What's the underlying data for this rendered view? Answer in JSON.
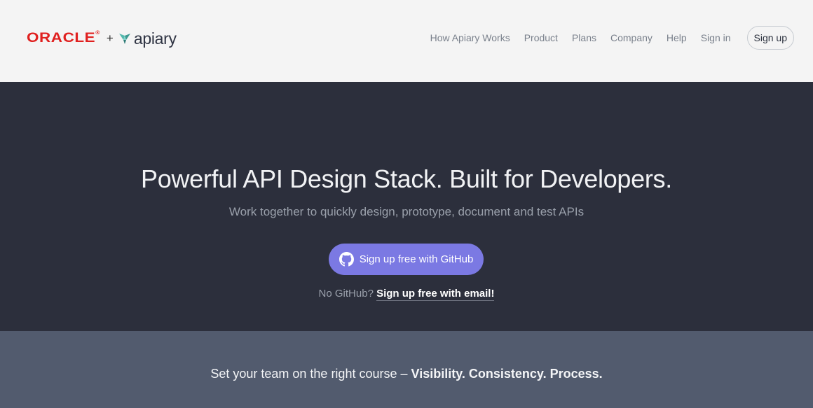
{
  "header": {
    "logo": {
      "oracle_text": "ORACLE",
      "registered_mark": "®",
      "plus": "+",
      "apiary_text": "apiary",
      "icon": "apiary-leaf-icon"
    },
    "nav": {
      "items": [
        {
          "label": "How Apiary Works"
        },
        {
          "label": "Product"
        },
        {
          "label": "Plans"
        },
        {
          "label": "Company"
        },
        {
          "label": "Help"
        },
        {
          "label": "Sign in"
        }
      ],
      "signup_label": "Sign up"
    }
  },
  "hero": {
    "title": "Powerful API Design Stack. Built for Developers.",
    "subtitle": "Work together to quickly design, prototype, document and test APIs",
    "github_button": {
      "label": "Sign up free with GitHub",
      "icon": "github-icon"
    },
    "alt_prefix": "No GitHub?",
    "alt_link": "Sign up free with email!"
  },
  "band": {
    "text_prefix": "Set your team on the right course –",
    "text_bold": "Visibility. Consistency. Process."
  },
  "colors": {
    "oracle_red": "#e0201f",
    "header_bg": "#f4f4f4",
    "hero_bg": "#2c2f3c",
    "button_purple": "#7b79e3",
    "band_bg": "#525b6e",
    "apiary_teal": "#4fb0a8"
  }
}
